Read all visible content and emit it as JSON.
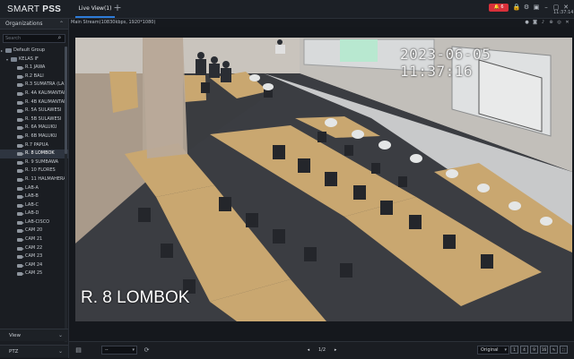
{
  "app": {
    "logo_light": "SMART ",
    "logo_bold": "PSS",
    "tab_label": "Live View(1)",
    "plus_icon": "+",
    "alarm_count": "6",
    "clock": "11:37:14",
    "top_icons": [
      "lock-icon",
      "gear-icon",
      "window-icon",
      "minimize-icon",
      "maximize-icon",
      "close-icon"
    ]
  },
  "sidebar": {
    "organizations_label": "Organizations",
    "search_placeholder": "Search",
    "default_group": "Default Group",
    "root": "KELAS IF",
    "devices": [
      "R.1 JAWA",
      "R.2 BALI",
      "R.3 SUMATRA (LA",
      "R. 4A KALIMANTAN",
      "R. 4B KALIMANTAN",
      "R. 5A SULAWESI",
      "R. 5B SULAWESI",
      "R. 6A MALUKU",
      "R. 6B MALUKU",
      "R.7 PAPUA",
      "R. 8 LOMBOK",
      "R. 9 SUMBAWA",
      "R. 10 FLORES",
      "R. 11 HALMAHERA",
      "LAB-A",
      "LAB-B",
      "LAB-C",
      "LAB-D",
      "LAB-CISCO",
      "CAM 20",
      "CAM 21",
      "CAM 22",
      "CAM 23",
      "CAM 24",
      "CAM 25"
    ],
    "selected_index": 10,
    "view_label": "View",
    "ptz_label": "PTZ"
  },
  "video": {
    "stream_info": "Main Stream(10830kbps, 1920*1080)",
    "timestamp": "2023-06-05  11:37:16",
    "camera_name": "R. 8 LOMBOK",
    "header_icons": [
      "record-icon",
      "snapshot-icon",
      "audio-icon",
      "zoom-icon",
      "fisheye-icon",
      "close-icon"
    ]
  },
  "bottom_bar": {
    "stream_select": "--",
    "page": "1/2",
    "prev": "◂",
    "next": "▸",
    "scale_select": "Original",
    "layout_options": [
      "1",
      "4",
      "9",
      "16"
    ]
  },
  "colors": {
    "accent": "#2d7bd8",
    "alarm": "#d8303a",
    "background": "#15181d"
  }
}
